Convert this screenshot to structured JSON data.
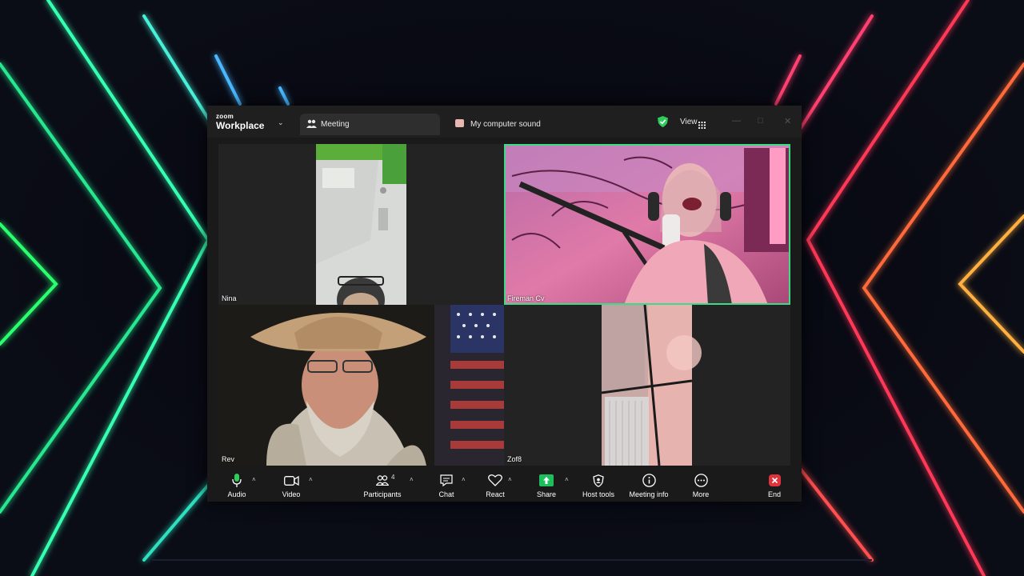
{
  "app": {
    "logo_small": "zoom",
    "logo_large": "Workplace",
    "tabs": [
      {
        "label": "Meeting",
        "icon": "participants-icon"
      },
      {
        "label": "My computer sound",
        "icon": "share-screen-icon"
      }
    ],
    "view_label": "View",
    "colors": {
      "accent": "#3ddc84",
      "share": "#1dbf5c",
      "end": "#e0323c"
    }
  },
  "participants": [
    {
      "name": "Nina"
    },
    {
      "name": "Fireman Cv",
      "active_speaker": true
    },
    {
      "name": "Rev"
    },
    {
      "name": "Zof8"
    }
  ],
  "toolbar": {
    "audio": "Audio",
    "video": "Video",
    "participants": "Participants",
    "participants_count": "4",
    "chat": "Chat",
    "react": "React",
    "share": "Share",
    "host_tools": "Host tools",
    "meeting_info": "Meeting info",
    "more": "More",
    "end": "End"
  }
}
